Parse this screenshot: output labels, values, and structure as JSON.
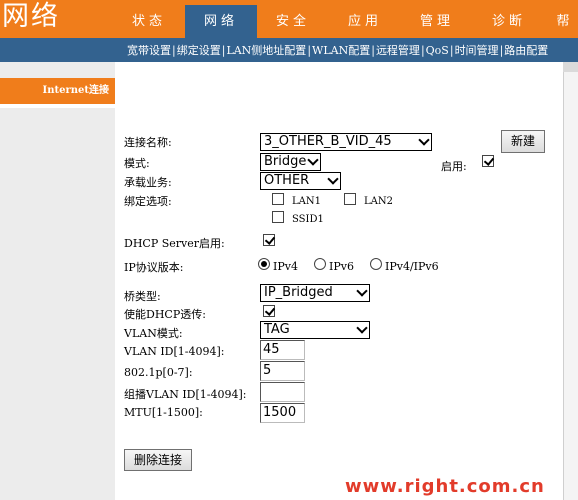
{
  "header": {
    "title": "网络",
    "tabs": [
      {
        "label": "状态",
        "active": false
      },
      {
        "label": "网络",
        "active": true
      },
      {
        "label": "安全",
        "active": false
      },
      {
        "label": "应用",
        "active": false
      },
      {
        "label": "管理",
        "active": false
      },
      {
        "label": "诊断",
        "active": false
      },
      {
        "label": "帮",
        "active": false
      }
    ]
  },
  "subnav": [
    "宽带设置",
    "绑定设置",
    "LAN侧地址配置",
    "WLAN配置",
    "远程管理",
    "QoS",
    "时间管理",
    "路由配置"
  ],
  "sidebar": {
    "active_item": "Internet连接"
  },
  "form": {
    "connection_name": {
      "label": "连接名称:",
      "value": "3_OTHER_B_VID_45"
    },
    "new_button": "新建",
    "mode": {
      "label": "模式:",
      "value": "Bridge"
    },
    "enable": {
      "label": "启用:",
      "checked": true
    },
    "service": {
      "label": "承载业务:",
      "value": "OTHER"
    },
    "binding": {
      "label": "绑定选项:",
      "options": [
        {
          "label": "LAN1",
          "checked": false
        },
        {
          "label": "LAN2",
          "checked": false
        },
        {
          "label": "SSID1",
          "checked": false
        }
      ]
    },
    "dhcp_server": {
      "label": "DHCP Server启用:",
      "checked": true
    },
    "ip_version": {
      "label": "IP协议版本:",
      "options": [
        "IPv4",
        "IPv6",
        "IPv4/IPv6"
      ],
      "selected": "IPv4"
    },
    "bridge_type": {
      "label": "桥类型:",
      "value": "IP_Bridged"
    },
    "dhcp_passthrough": {
      "label": "使能DHCP透传:",
      "checked": true
    },
    "vlan_mode": {
      "label": "VLAN模式:",
      "value": "TAG"
    },
    "vlan_id": {
      "label": "VLAN ID[1-4094]:",
      "value": "45"
    },
    "priority": {
      "label": "802.1p[0-7]:",
      "value": "5"
    },
    "multicast_vlan": {
      "label": "组播VLAN ID[1-4094]:",
      "value": ""
    },
    "mtu": {
      "label": "MTU[1-1500]:",
      "value": "1500"
    },
    "delete_button": "删除连接"
  },
  "watermark": "www.right.com.cn",
  "colors": {
    "orange": "#f07d1b",
    "blue": "#33628f",
    "watermark": "#e23b2a"
  }
}
